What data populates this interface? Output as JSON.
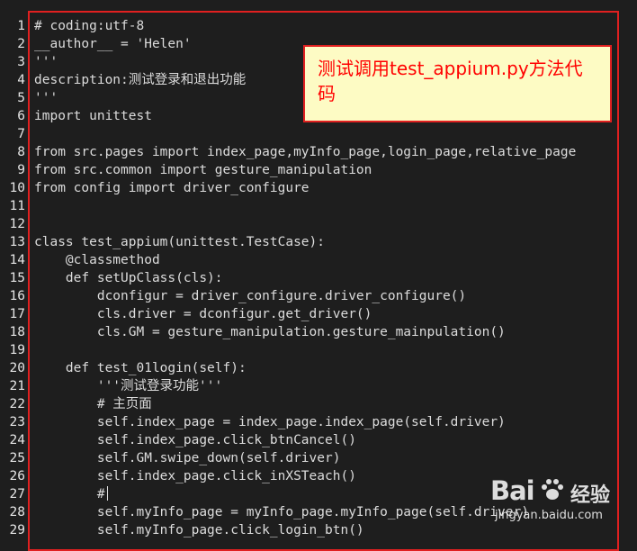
{
  "editor": {
    "lines": [
      {
        "num": "1",
        "text": "# coding:utf-8"
      },
      {
        "num": "2",
        "text": "__author__ = 'Helen'"
      },
      {
        "num": "3",
        "text": "'''"
      },
      {
        "num": "4",
        "text": "description:测试登录和退出功能"
      },
      {
        "num": "5",
        "text": "'''"
      },
      {
        "num": "6",
        "text": "import unittest"
      },
      {
        "num": "7",
        "text": ""
      },
      {
        "num": "8",
        "text": "from src.pages import index_page,myInfo_page,login_page,relative_page"
      },
      {
        "num": "9",
        "text": "from src.common import gesture_manipulation"
      },
      {
        "num": "10",
        "text": "from config import driver_configure"
      },
      {
        "num": "11",
        "text": ""
      },
      {
        "num": "12",
        "text": ""
      },
      {
        "num": "13",
        "text": "class test_appium(unittest.TestCase):"
      },
      {
        "num": "14",
        "text": "    @classmethod"
      },
      {
        "num": "15",
        "text": "    def setUpClass(cls):"
      },
      {
        "num": "16",
        "text": "        dconfigur = driver_configure.driver_configure()"
      },
      {
        "num": "17",
        "text": "        cls.driver = dconfigur.get_driver()"
      },
      {
        "num": "18",
        "text": "        cls.GM = gesture_manipulation.gesture_mainpulation()"
      },
      {
        "num": "19",
        "text": ""
      },
      {
        "num": "20",
        "text": "    def test_01login(self):"
      },
      {
        "num": "21",
        "text": "        '''测试登录功能'''"
      },
      {
        "num": "22",
        "text": "        # 主页面"
      },
      {
        "num": "23",
        "text": "        self.index_page = index_page.index_page(self.driver)"
      },
      {
        "num": "24",
        "text": "        self.index_page.click_btnCancel()"
      },
      {
        "num": "25",
        "text": "        self.GM.swipe_down(self.driver)"
      },
      {
        "num": "26",
        "text": "        self.index_page.click_inXSTeach()"
      },
      {
        "num": "27",
        "text": "        #"
      },
      {
        "num": "28",
        "text": "        self.myInfo_page = myInfo_page.myInfo_page(self.driver)"
      },
      {
        "num": "29",
        "text": "        self.myInfo_page.click_login_btn()"
      }
    ]
  },
  "callout": {
    "text": "测试调用test_appium.py方法代码"
  },
  "watermark": {
    "logo": "Bai",
    "jingyan": "经验",
    "url": "jingyan.baidu.com"
  },
  "colors": {
    "background": "#1e1e1e",
    "code_text": "#dcdcdc",
    "highlight_border": "#e02020",
    "callout_bg": "#fdfbc4",
    "callout_text": "#ff0000"
  }
}
